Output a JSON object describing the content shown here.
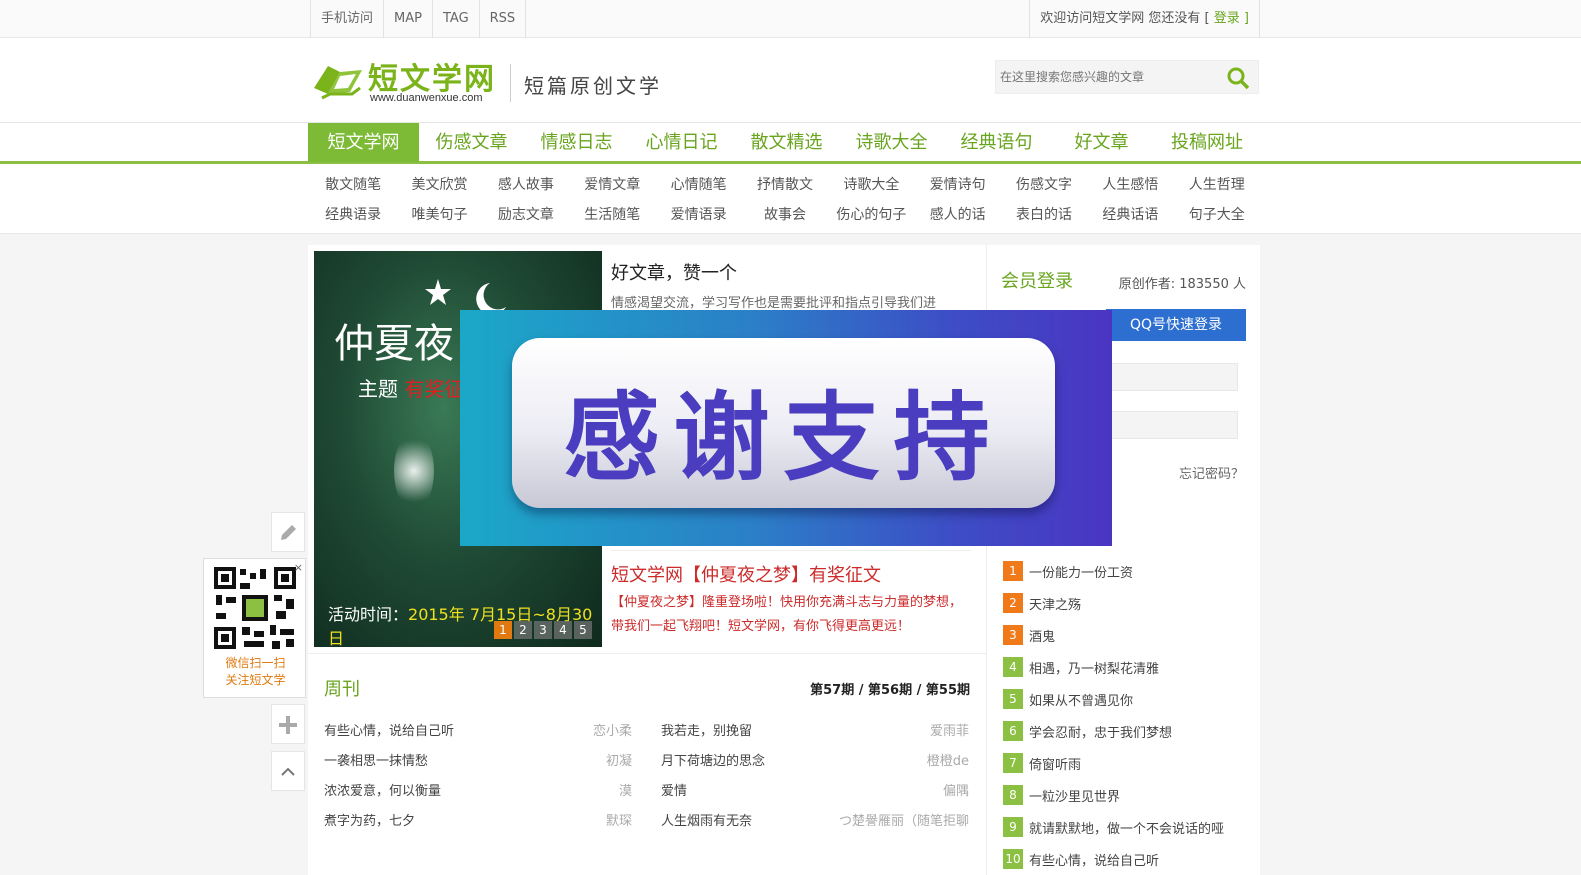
{
  "topbar": {
    "links": [
      "手机访问",
      "MAP",
      "TAG",
      "RSS"
    ],
    "welcome": "欢迎访问短文学网 您还没有 [ ",
    "login": "登录",
    "close_bracket": " ]"
  },
  "header": {
    "logo_text": "短文学网",
    "logo_url": "www.duanwenxue.com",
    "slogan": "短篇原创文学",
    "search_placeholder": "在这里搜索您感兴趣的文章"
  },
  "nav": [
    "短文学网",
    "伤感文章",
    "情感日志",
    "心情日记",
    "散文精选",
    "诗歌大全",
    "经典语句",
    "好文章",
    "投稿网址"
  ],
  "subnav": {
    "row1": [
      "散文随笔",
      "美文欣赏",
      "感人故事",
      "爱情文章",
      "心情随笔",
      "抒情散文",
      "诗歌大全",
      "爱情诗句",
      "伤感文字",
      "人生感悟",
      "人生哲理"
    ],
    "row2": [
      "经典语录",
      "唯美句子",
      "励志文章",
      "生活随笔",
      "爱情语录",
      "故事会",
      "伤心的句子",
      "感人的话",
      "表白的话",
      "经典话语",
      "句子大全"
    ]
  },
  "banner": {
    "title1": "仲夏夜",
    "title2a": "主题",
    "title2b": "有奖征",
    "time_label": "活动时间：",
    "time_value": "2015年 7月15日~8月30日",
    "pages": [
      "1",
      "2",
      "3",
      "4",
      "5"
    ]
  },
  "article1": {
    "title": "好文章，赞一个",
    "body": "情感渴望交流，学习写作也是需要批评和指点引导我们进"
  },
  "article2": {
    "title": "短文学网【仲夏夜之梦】有奖征文",
    "body": "【仲夏夜之梦】隆重登场啦！快用你充满斗志与力量的梦想，带我们一起飞翔吧！短文学网，有你飞得更高更远！"
  },
  "weekly": {
    "title": "周刊",
    "issues": "第57期 / 第56期 / 第55期",
    "left": [
      {
        "title": "有些心情，说给自己听",
        "author": "恋小柔"
      },
      {
        "title": "一袭相思一抹情愁",
        "author": "初凝"
      },
      {
        "title": "浓浓爱意，何以衡量",
        "author": "漠"
      },
      {
        "title": "煮字为药，七夕",
        "author": "默琛"
      }
    ],
    "right": [
      {
        "title": "我若走，别挽留",
        "author": "爱雨菲"
      },
      {
        "title": "月下荷塘边的思念",
        "author": "橙橙de"
      },
      {
        "title": "爱情",
        "author": "偏隅"
      },
      {
        "title": "人生烟雨有无奈",
        "author": "つ楚譽雁丽（随笔拒聊"
      }
    ]
  },
  "sidebar": {
    "member_title": "会员登录",
    "members": "原创作者: 183550 人",
    "qq_login": "QQ号快速登录",
    "forgot": "忘记密码？",
    "ranking": [
      "一份能力一份工资",
      "天津之殇",
      "酒鬼",
      "相遇，乃一树梨花清雅",
      "如果从不曾遇见你",
      "学会忍耐，忠于我们梦想",
      "倚窗听雨",
      "一粒沙里见世界",
      "就请默默地，做一个不会说话的哑",
      "有些心情，说给自己听"
    ]
  },
  "qr": {
    "line1": "微信扫一扫",
    "line2": "关注短文学",
    "close": "×"
  },
  "overlay": {
    "text": "感谢支持"
  },
  "colors": {
    "brand_green": "#7dba35",
    "rank_orange": "#f07a1a",
    "rank_green": "#8cc043",
    "qq_blue": "#2c6fd1"
  }
}
